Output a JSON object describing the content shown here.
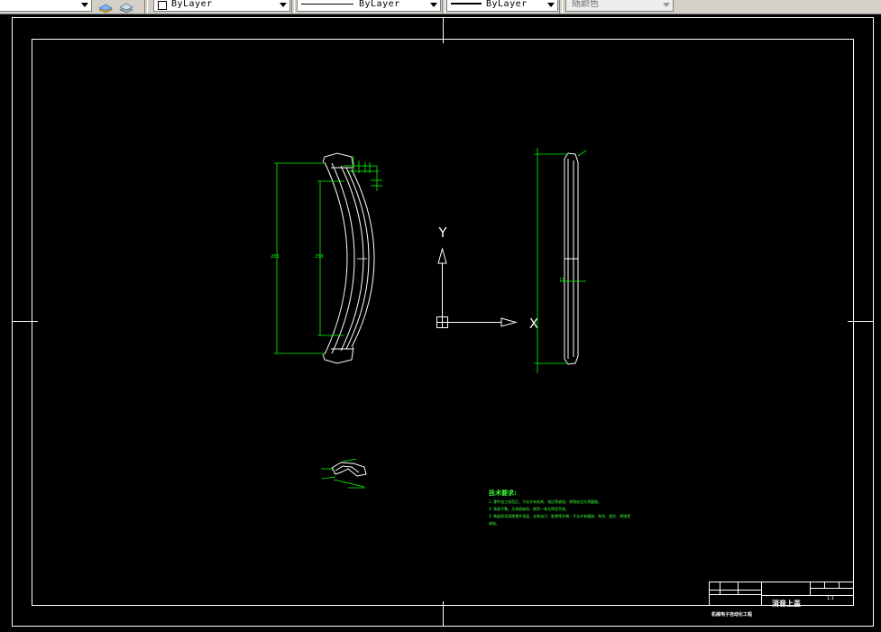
{
  "toolbar": {
    "layer_color_value": "ByLayer",
    "linetype_value": "ByLayer",
    "lineweight_value": "ByLayer",
    "plotstyle_value": "随颜色"
  },
  "drawing": {
    "axis_y_label": "Y",
    "axis_x_label": "X",
    "notes_title": "技术要求:",
    "notes": [
      "1. 零件加工成型后，不允许有毛刺、锐边等缺陷，倒角处应光滑圆顺。",
      "2. 表面平整，无划痕缺陷，颜色一致无明显色差。",
      "3. 装配前须清理零件表面，去除油污、脏物等异物，不允许有磕碰、划伤、变形、锈蚀等",
      "缺陷。"
    ]
  },
  "title_block": {
    "part_name": "消音上盖",
    "scale": "1:1",
    "institution": "机械电子自动化工程"
  },
  "colors": {
    "background": "#000000",
    "frame": "#ffffff",
    "dimension": "#00ff00",
    "notes": "#3cff3c"
  }
}
